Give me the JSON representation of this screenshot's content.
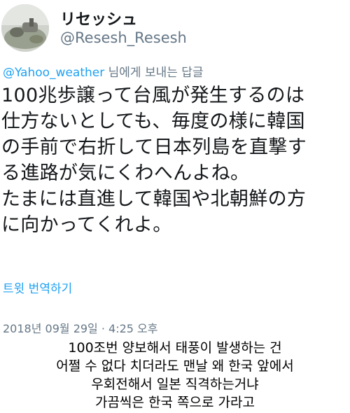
{
  "tweet": {
    "display_name": "リセッシュ",
    "handle": "@Resesh_Resesh",
    "reply_to": {
      "handle": "@Yahoo_weather",
      "suffix": " 님에게 보내는 답글"
    },
    "text_lines": [
      "100兆歩譲って台風が発生するのは",
      "仕方ないとしても、毎度の様に韓国",
      "の手前で右折して日本列島を直撃す",
      "る進路が気にくわへんよね。",
      "たまには直進して韓国や北朝鮮の方",
      "に向かってくれよ。"
    ],
    "translate_label": "트윗 번역하기",
    "timestamp": "2018년 09월 29일 · 4:25 오후"
  },
  "caption_lines": [
    "100조번 양보해서 태풍이 발생하는 건",
    "어쩔 수 없다 치더라도 맨날 왜 한국 앞에서",
    "우회전해서 일본 직격하는거냐",
    "가끔씩은 한국 쪽으로 가라고"
  ]
}
